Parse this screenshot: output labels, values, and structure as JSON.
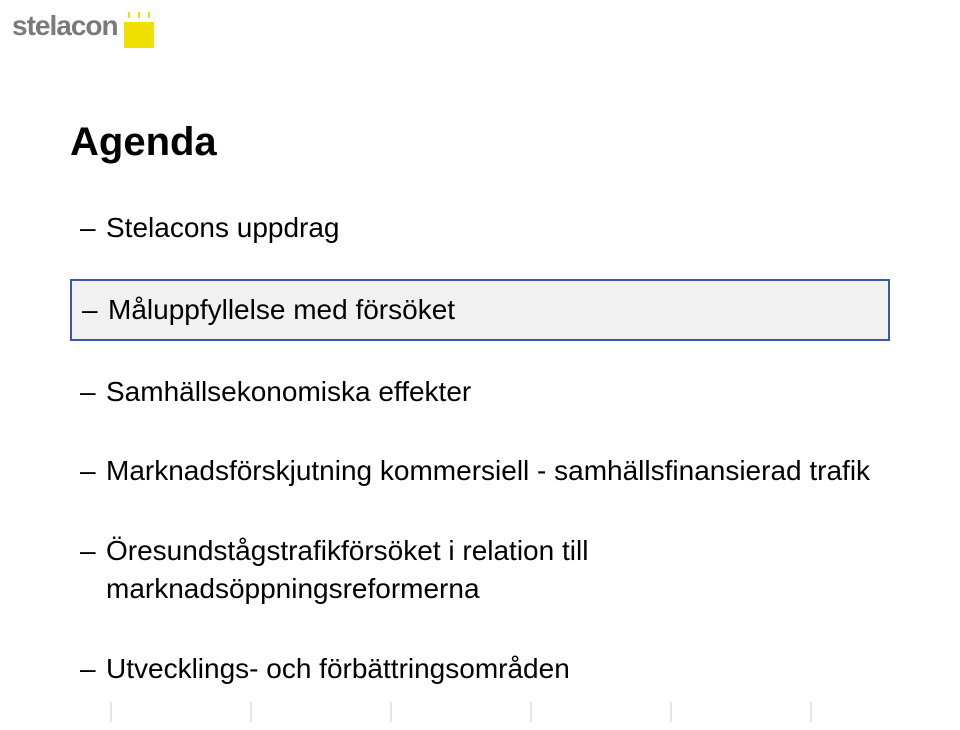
{
  "brand": {
    "name": "stelacon"
  },
  "title": "Agenda",
  "items": [
    {
      "text": "Stelacons uppdrag",
      "highlighted": false
    },
    {
      "text": "Måluppfyllelse med försöket",
      "highlighted": true
    },
    {
      "text": "Samhällsekonomiska effekter",
      "highlighted": false
    },
    {
      "text": "Marknadsförskjutning kommersiell - samhällsfinansierad trafik",
      "highlighted": false
    },
    {
      "text": "Öresundstågstrafikförsöket i relation till marknadsöppningsreformerna",
      "highlighted": false
    },
    {
      "text": "Utvecklings- och förbättringsområden",
      "highlighted": false
    }
  ]
}
